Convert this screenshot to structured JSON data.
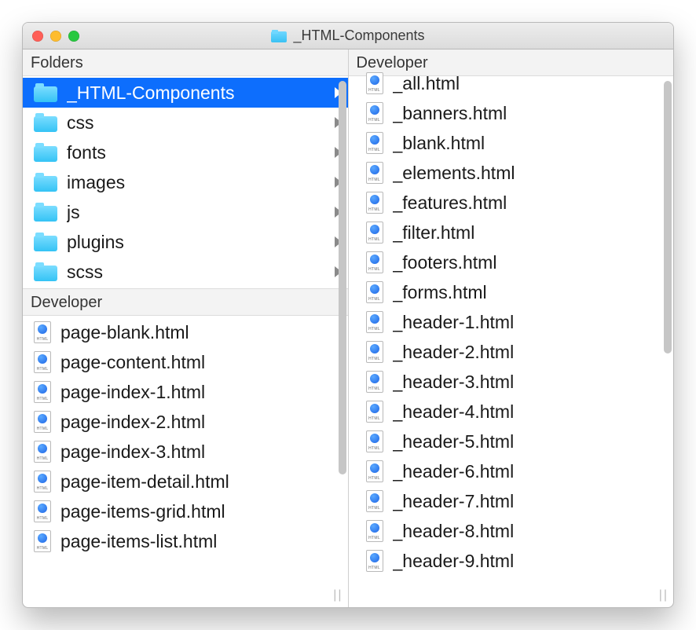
{
  "window": {
    "title": "_HTML-Components"
  },
  "leftPane": {
    "foldersHeader": "Folders",
    "folders": [
      {
        "name": "_HTML-Components",
        "selected": true
      },
      {
        "name": "css"
      },
      {
        "name": "fonts"
      },
      {
        "name": "images"
      },
      {
        "name": "js"
      },
      {
        "name": "plugins"
      },
      {
        "name": "scss"
      }
    ],
    "devHeader": "Developer",
    "devFiles": [
      "page-blank.html",
      "page-content.html",
      "page-index-1.html",
      "page-index-2.html",
      "page-index-3.html",
      "page-item-detail.html",
      "page-items-grid.html",
      "page-items-list.html"
    ]
  },
  "rightPane": {
    "devHeader": "Developer",
    "devFiles": [
      "_all.html",
      "_banners.html",
      "_blank.html",
      "_elements.html",
      "_features.html",
      "_filter.html",
      "_footers.html",
      "_forms.html",
      "_header-1.html",
      "_header-2.html",
      "_header-3.html",
      "_header-4.html",
      "_header-5.html",
      "_header-6.html",
      "_header-7.html",
      "_header-8.html",
      "_header-9.html"
    ]
  }
}
